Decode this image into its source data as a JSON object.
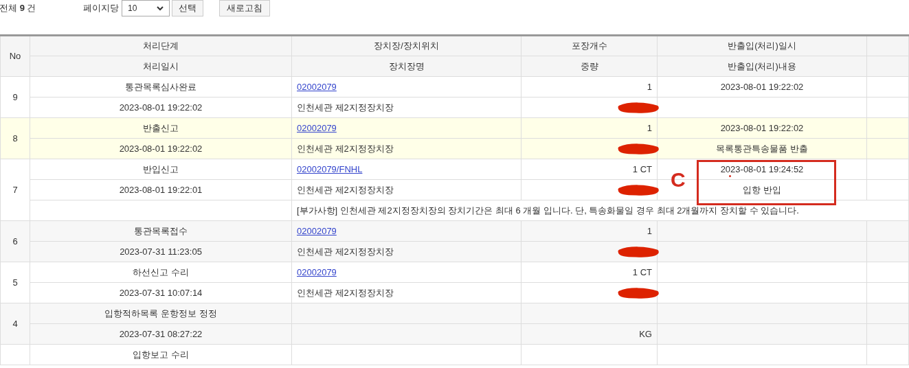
{
  "toolbar": {
    "total": "전체 **9** 건",
    "per_page_label": "페이지당",
    "per_page_value": "10",
    "select_button": "선택",
    "refresh_button": "새로고침"
  },
  "table": {
    "columns_top": [
      "No",
      "처리단계",
      "장치장/장치위치",
      "포장개수",
      "반출입(처리)일시"
    ],
    "columns_bottom": [
      "처리일시",
      "장치장명",
      "중량",
      "반출입(처리)내용"
    ],
    "rows": [
      {
        "no": "9",
        "stage": "통관목록심사완료",
        "datetime": "2023-08-01 19:22:02",
        "location": "02002079",
        "location_name": "인천세관 제2지정장치장",
        "count": "1",
        "weight_redacted": true,
        "io_datetime": "2023-08-01 19:22:02",
        "highlighted": false
      },
      {
        "no": "8",
        "stage": "반출신고",
        "datetime": "2023-08-01 19:22:02",
        "location": "02002079",
        "location_name": "인천세관 제2지정장치장",
        "count": "1",
        "weight_redacted": true,
        "io_datetime": "2023-08-01 19:22:02",
        "io_content": "목록통관특송물품 반출",
        "highlighted": true
      },
      {
        "no": "7",
        "stage": "반입신고",
        "datetime": "2023-08-01 19:22:01",
        "location": "02002079/FNHL",
        "location_name": "인천세관 제2지정장치장",
        "count": "1 CT",
        "weight_redacted": true,
        "io_datetime": "2023-08-01 19:24:52",
        "io_content": "입항 반입",
        "note": "[부가사항] 인천세관 제2지정장치장의 장치기간은 최대 6 개월 입니다. 단, 특송화물일 경우 최대 2개월까지 장치할 수 있습니다.",
        "highlighted": false
      },
      {
        "no": "6",
        "stage": "통관목록접수",
        "datetime": "2023-07-31 11:23:05",
        "location": "02002079",
        "location_name": "인천세관 제2지정장치장",
        "count": "1",
        "weight_redacted": true,
        "highlighted": false
      },
      {
        "no": "5",
        "stage": "하선신고 수리",
        "datetime": "2023-07-31 10:07:14",
        "location": "02002079",
        "location_name": "인천세관 제2지정장치장",
        "count": "1 CT",
        "weight_redacted": true,
        "highlighted": false
      },
      {
        "no": "4",
        "stage": "입항적하목록 운항정보 정정",
        "datetime": "2023-07-31 08:27:22",
        "weight": "KG",
        "weight_redacted": false,
        "highlighted": false
      },
      {
        "stage": "입항보고 수리",
        "highlighted": false
      }
    ]
  },
  "annotation": {
    "label": "C"
  }
}
